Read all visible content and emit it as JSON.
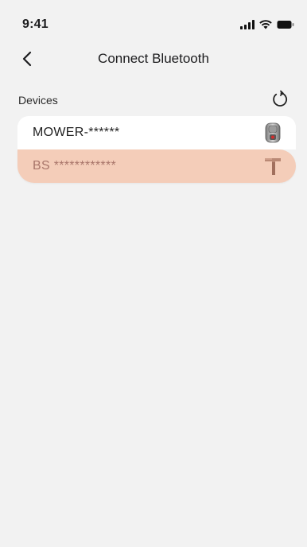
{
  "status_bar": {
    "time": "9:41",
    "signal_icon": "cellular-signal-icon",
    "wifi_icon": "wifi-icon",
    "battery_icon": "battery-icon"
  },
  "nav": {
    "back_icon": "chevron-left-icon",
    "title": "Connect Bluetooth"
  },
  "devices_section": {
    "label": "Devices",
    "refresh_icon": "refresh-icon"
  },
  "devices": [
    {
      "name": "MOWER-******",
      "icon": "mower-icon",
      "selected": false
    },
    {
      "name": "BS ************",
      "icon": "base-station-icon",
      "selected": true
    }
  ],
  "colors": {
    "background": "#f2f2f2",
    "card": "#ffffff",
    "selected_card": "#f4cdb9",
    "selected_text": "#a8756a"
  }
}
